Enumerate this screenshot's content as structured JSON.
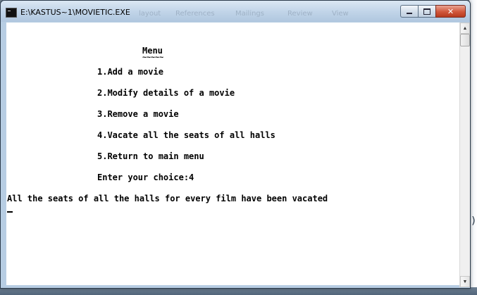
{
  "window": {
    "title": "E:\\KASTUS~1\\MOVIETIC.EXE",
    "ghost_menu": [
      "layout",
      "References",
      "Mailings",
      "Review",
      "View"
    ]
  },
  "caption_buttons": {
    "minimize": "minimize",
    "maximize": "maximize",
    "close": "✕"
  },
  "console": {
    "heading": "Menu",
    "heading_underline": "~~~~~",
    "items": [
      "1.Add a movie",
      "2.Modify details of a movie",
      "3.Remove a movie",
      "4.Vacate all the seats of all halls",
      "5.Return to main menu"
    ],
    "prompt": "Enter your choice:4",
    "result": "All the seats of all the halls for every film have been vacated"
  },
  "scrollbar": {
    "up_glyph": "▲",
    "down_glyph": "▼"
  },
  "background": {
    "edge_text": ")"
  }
}
